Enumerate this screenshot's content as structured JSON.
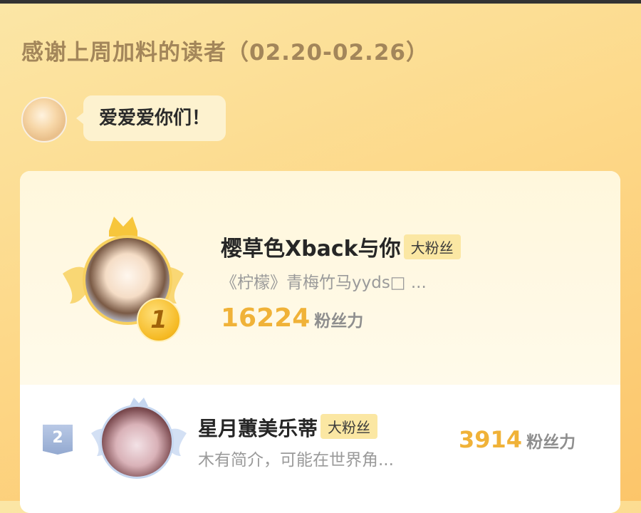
{
  "header": {
    "title": "感谢上周加料的读者（02.20-02.26）"
  },
  "author_message": {
    "avatar": "author-avatar",
    "text": "爱爱爱你们！"
  },
  "ranking": [
    {
      "rank": "1",
      "name": "樱草色Xback与你",
      "badge": "大粉丝",
      "bio": "《柠檬》青梅竹马yyds□ ...",
      "score": "16224",
      "score_unit": "粉丝力"
    },
    {
      "rank": "2",
      "name": "星月蕙美乐蒂",
      "badge": "大粉丝",
      "bio": "木有简介，可能在世界角...",
      "score": "3914",
      "score_unit": "粉丝力"
    }
  ],
  "colors": {
    "accent": "#f0b238",
    "badge_bg": "#fbe7a3",
    "background": "#fdd98a"
  }
}
